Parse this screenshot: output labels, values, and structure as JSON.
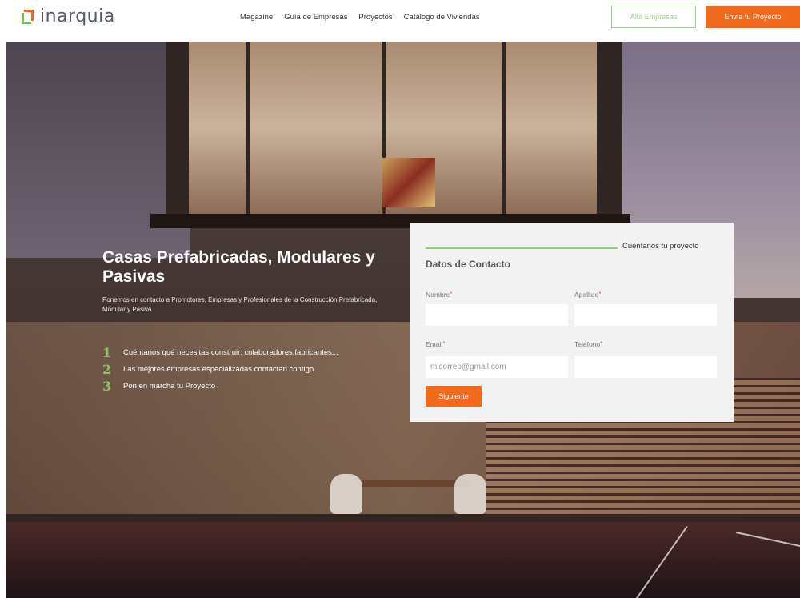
{
  "header": {
    "logo_text": "inarquia",
    "nav": [
      "Magazine",
      "Guía de Empresas",
      "Proyectos",
      "Catálogo de Viviendas"
    ],
    "btn_alta": "Alta Empresas",
    "btn_envia": "Envía tu Proyecto"
  },
  "hero": {
    "title": "Casas Prefabricadas, Modulares y Pasivas",
    "subtitle": "Ponemos en contacto a Promotores, Empresas y Profesionales de la Construcción Prefabricada, Modular y Pasiva",
    "steps": [
      {
        "num": "1",
        "text": "Cuéntanos qué necesitas construir: colaboradores,fabricantes..."
      },
      {
        "num": "2",
        "text": "Las mejores empresas especializadas contactan contigo"
      },
      {
        "num": "3",
        "text": "Pon en marcha tu Proyecto"
      }
    ]
  },
  "form": {
    "step_label": "Cuéntanos tu proyecto",
    "title": "Datos de Contacto",
    "fields": {
      "nombre": {
        "label": "Nombre",
        "value": "",
        "placeholder": ""
      },
      "apellido": {
        "label": "Apellido",
        "value": "",
        "placeholder": ""
      },
      "email": {
        "label": "Email",
        "value": "",
        "placeholder": "micorreo@gmail.com"
      },
      "telefono": {
        "label": "Telefono",
        "value": "",
        "placeholder": ""
      }
    },
    "required_mark": "*",
    "submit": "Siguiente"
  },
  "colors": {
    "accent_orange": "#f26b1d",
    "accent_green": "#8fd16d"
  }
}
